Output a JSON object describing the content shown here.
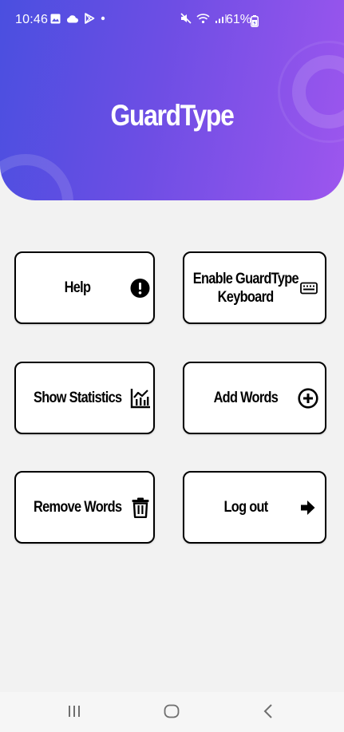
{
  "status_bar": {
    "time": "10:46",
    "left_icons": [
      "gallery-icon",
      "cloud-icon",
      "play-store-icon",
      "notification-dot-icon"
    ],
    "right_icons": [
      "mute-icon",
      "wifi-icon",
      "signal-icon"
    ],
    "battery_percent": "61%",
    "battery_icon": "battery-charging-icon"
  },
  "header": {
    "title": "GuardType",
    "gradient_start": "#4a4fe0",
    "gradient_end": "#9d56ee"
  },
  "menu": {
    "help_label": "Help",
    "help_icon": "exclamation-circle-icon",
    "enable_keyboard_label_line1": "Enable GuardType",
    "enable_keyboard_label_line2": "Keyboard",
    "enable_keyboard_icon": "keyboard-icon",
    "show_statistics_label": "Show Statistics",
    "show_statistics_icon": "chart-icon",
    "add_words_label": "Add Words",
    "add_words_icon": "plus-circle-icon",
    "remove_words_label": "Remove Words",
    "remove_words_icon": "trash-icon",
    "logout_label": "Log out",
    "logout_icon": "arrow-right-icon"
  },
  "nav_bar": {
    "recents_icon": "recents-icon",
    "home_icon": "home-icon",
    "back_icon": "back-icon"
  },
  "colors": {
    "background": "#f2f2f2",
    "card_background": "#ffffff",
    "card_border": "#000000",
    "header_text": "#ffffff"
  }
}
